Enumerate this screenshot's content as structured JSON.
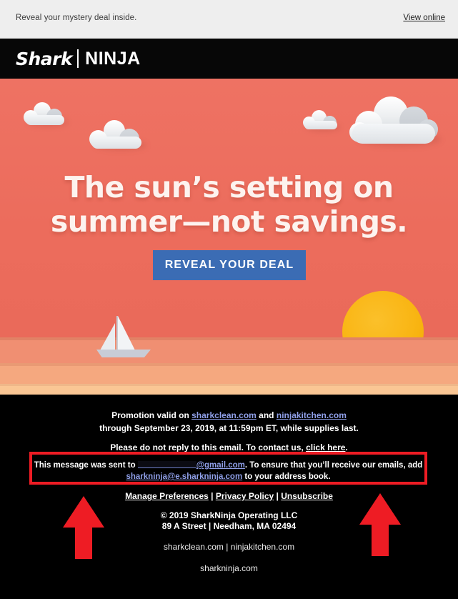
{
  "preheader": {
    "text": "Reveal your mystery deal inside.",
    "view_online_label": "View online"
  },
  "header": {
    "logo_primary": "Shark",
    "logo_secondary": "NINJA"
  },
  "hero": {
    "headline_line1": "The sun’s setting on",
    "headline_line2": "summer—not savings.",
    "cta_label": "REVEAL YOUR DEAL",
    "background_color": "#ec6d5d",
    "cta_color": "#3b6cb4",
    "sun_color": "#f9b513"
  },
  "footer": {
    "promo_prefix": "Promotion valid on ",
    "promo_link1": "sharkclean.com",
    "promo_and": " and ",
    "promo_link2": "ninjakitchen.com",
    "promo_line2": "through September 23, 2019, at 11:59pm ET, while supplies last.",
    "noreply_prefix": "Please do not reply to this email. To contact us, ",
    "noreply_link": "click here",
    "noreply_suffix": ".",
    "sent_to_prefix": "This message was sent to ",
    "sent_to_email_domain": "@gmail.com",
    "sent_to_mid": ". To ensure that you’ll receive our emails, add ",
    "sent_to_address": "sharkninja@e.sharkninja.com",
    "sent_to_suffix": " to your address book.",
    "manage_preferences": "Manage Preferences",
    "separator": " | ",
    "privacy_policy": "Privacy Policy",
    "unsubscribe": "Unsubscribe",
    "copyright_line1": "© 2019 SharkNinja Operating LLC",
    "copyright_line2": "89 A Street | Needham, MA 02494",
    "sites_line": "sharkclean.com | ninjakitchen.com",
    "corp_line": "sharkninja.com",
    "highlight_color": "#ee1c24",
    "link_color": "#8f9fe8"
  }
}
